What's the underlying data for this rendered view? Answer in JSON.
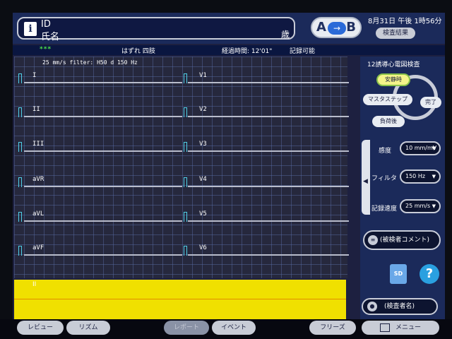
{
  "header": {
    "id_label": "ID",
    "name_label": "氏名",
    "age_label": "歳",
    "ab_a": "A",
    "ab_b": "B",
    "ab_arrow": "→",
    "datetime": "8月31日 午後 1時56分",
    "results_button": "検査結果"
  },
  "status": {
    "indicator": "***",
    "warning": "はずれ 四肢",
    "elapsed": "経過時間: 12'01\"",
    "recordable": "記録可能"
  },
  "ecg": {
    "filter_info": "25 mm/s filter: H50 d 150 Hz",
    "leads_left": [
      "I",
      "II",
      "III",
      "aVR",
      "aVL",
      "aVF"
    ],
    "leads_right": [
      "V1",
      "V2",
      "V3",
      "V4",
      "V5",
      "V6"
    ],
    "rhythm_label": "II"
  },
  "panel": {
    "title": "12誘導心電図検査",
    "steps": {
      "rest": "安静時",
      "master": "マスタステップ",
      "done": "完了",
      "after_load": "負荷後"
    },
    "sensitivity_label": "感度",
    "sensitivity_value": "10 mm/mV",
    "filter_label": "フィルタ",
    "filter_value": "150 Hz",
    "speed_label": "記録速度",
    "speed_value": "25 mm/s",
    "comment_button": "(被検者コメント)",
    "examiner_button": "(検査者名)",
    "sd_label": "SD",
    "help_label": "?"
  },
  "bottom": {
    "review": "レビュー",
    "rhythm": "リズム",
    "report": "レポート",
    "event": "イベント",
    "freeze": "フリーズ",
    "menu": "メニュー"
  },
  "colors": {
    "header_bg": "#1b2a5a",
    "ecg_bg": "#26283d",
    "rhythm_strip": "#f0e000",
    "calibration": "#4fd0e8",
    "status_ok": "#4be04b"
  }
}
